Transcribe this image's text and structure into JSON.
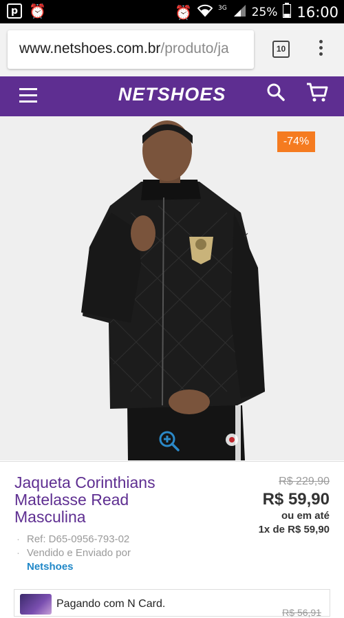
{
  "status_bar": {
    "app_icon_letter": "p",
    "battery": "25%",
    "time": "16:00",
    "network": "3G"
  },
  "browser": {
    "url_host": "www.netshoes.com.br",
    "url_path": "/produto/ja",
    "tab_count": "10"
  },
  "header": {
    "logo": "NETSHOES",
    "brand_color": "#5e2e91"
  },
  "product": {
    "discount": "-74%",
    "title": "Jaqueta Corinthians Matelasse Read Masculina",
    "old_price": "R$ 229,90",
    "price": "R$ 59,90",
    "installment_line1": "ou em até",
    "installment_line2": "1x de R$ 59,90",
    "ref": "Ref: D65-0956-793-02",
    "sold_by": "Vendido e Enviado por",
    "seller": "Netshoes"
  },
  "ncard": {
    "text": "Pagando com N Card.",
    "price": "R$ 56,91"
  }
}
